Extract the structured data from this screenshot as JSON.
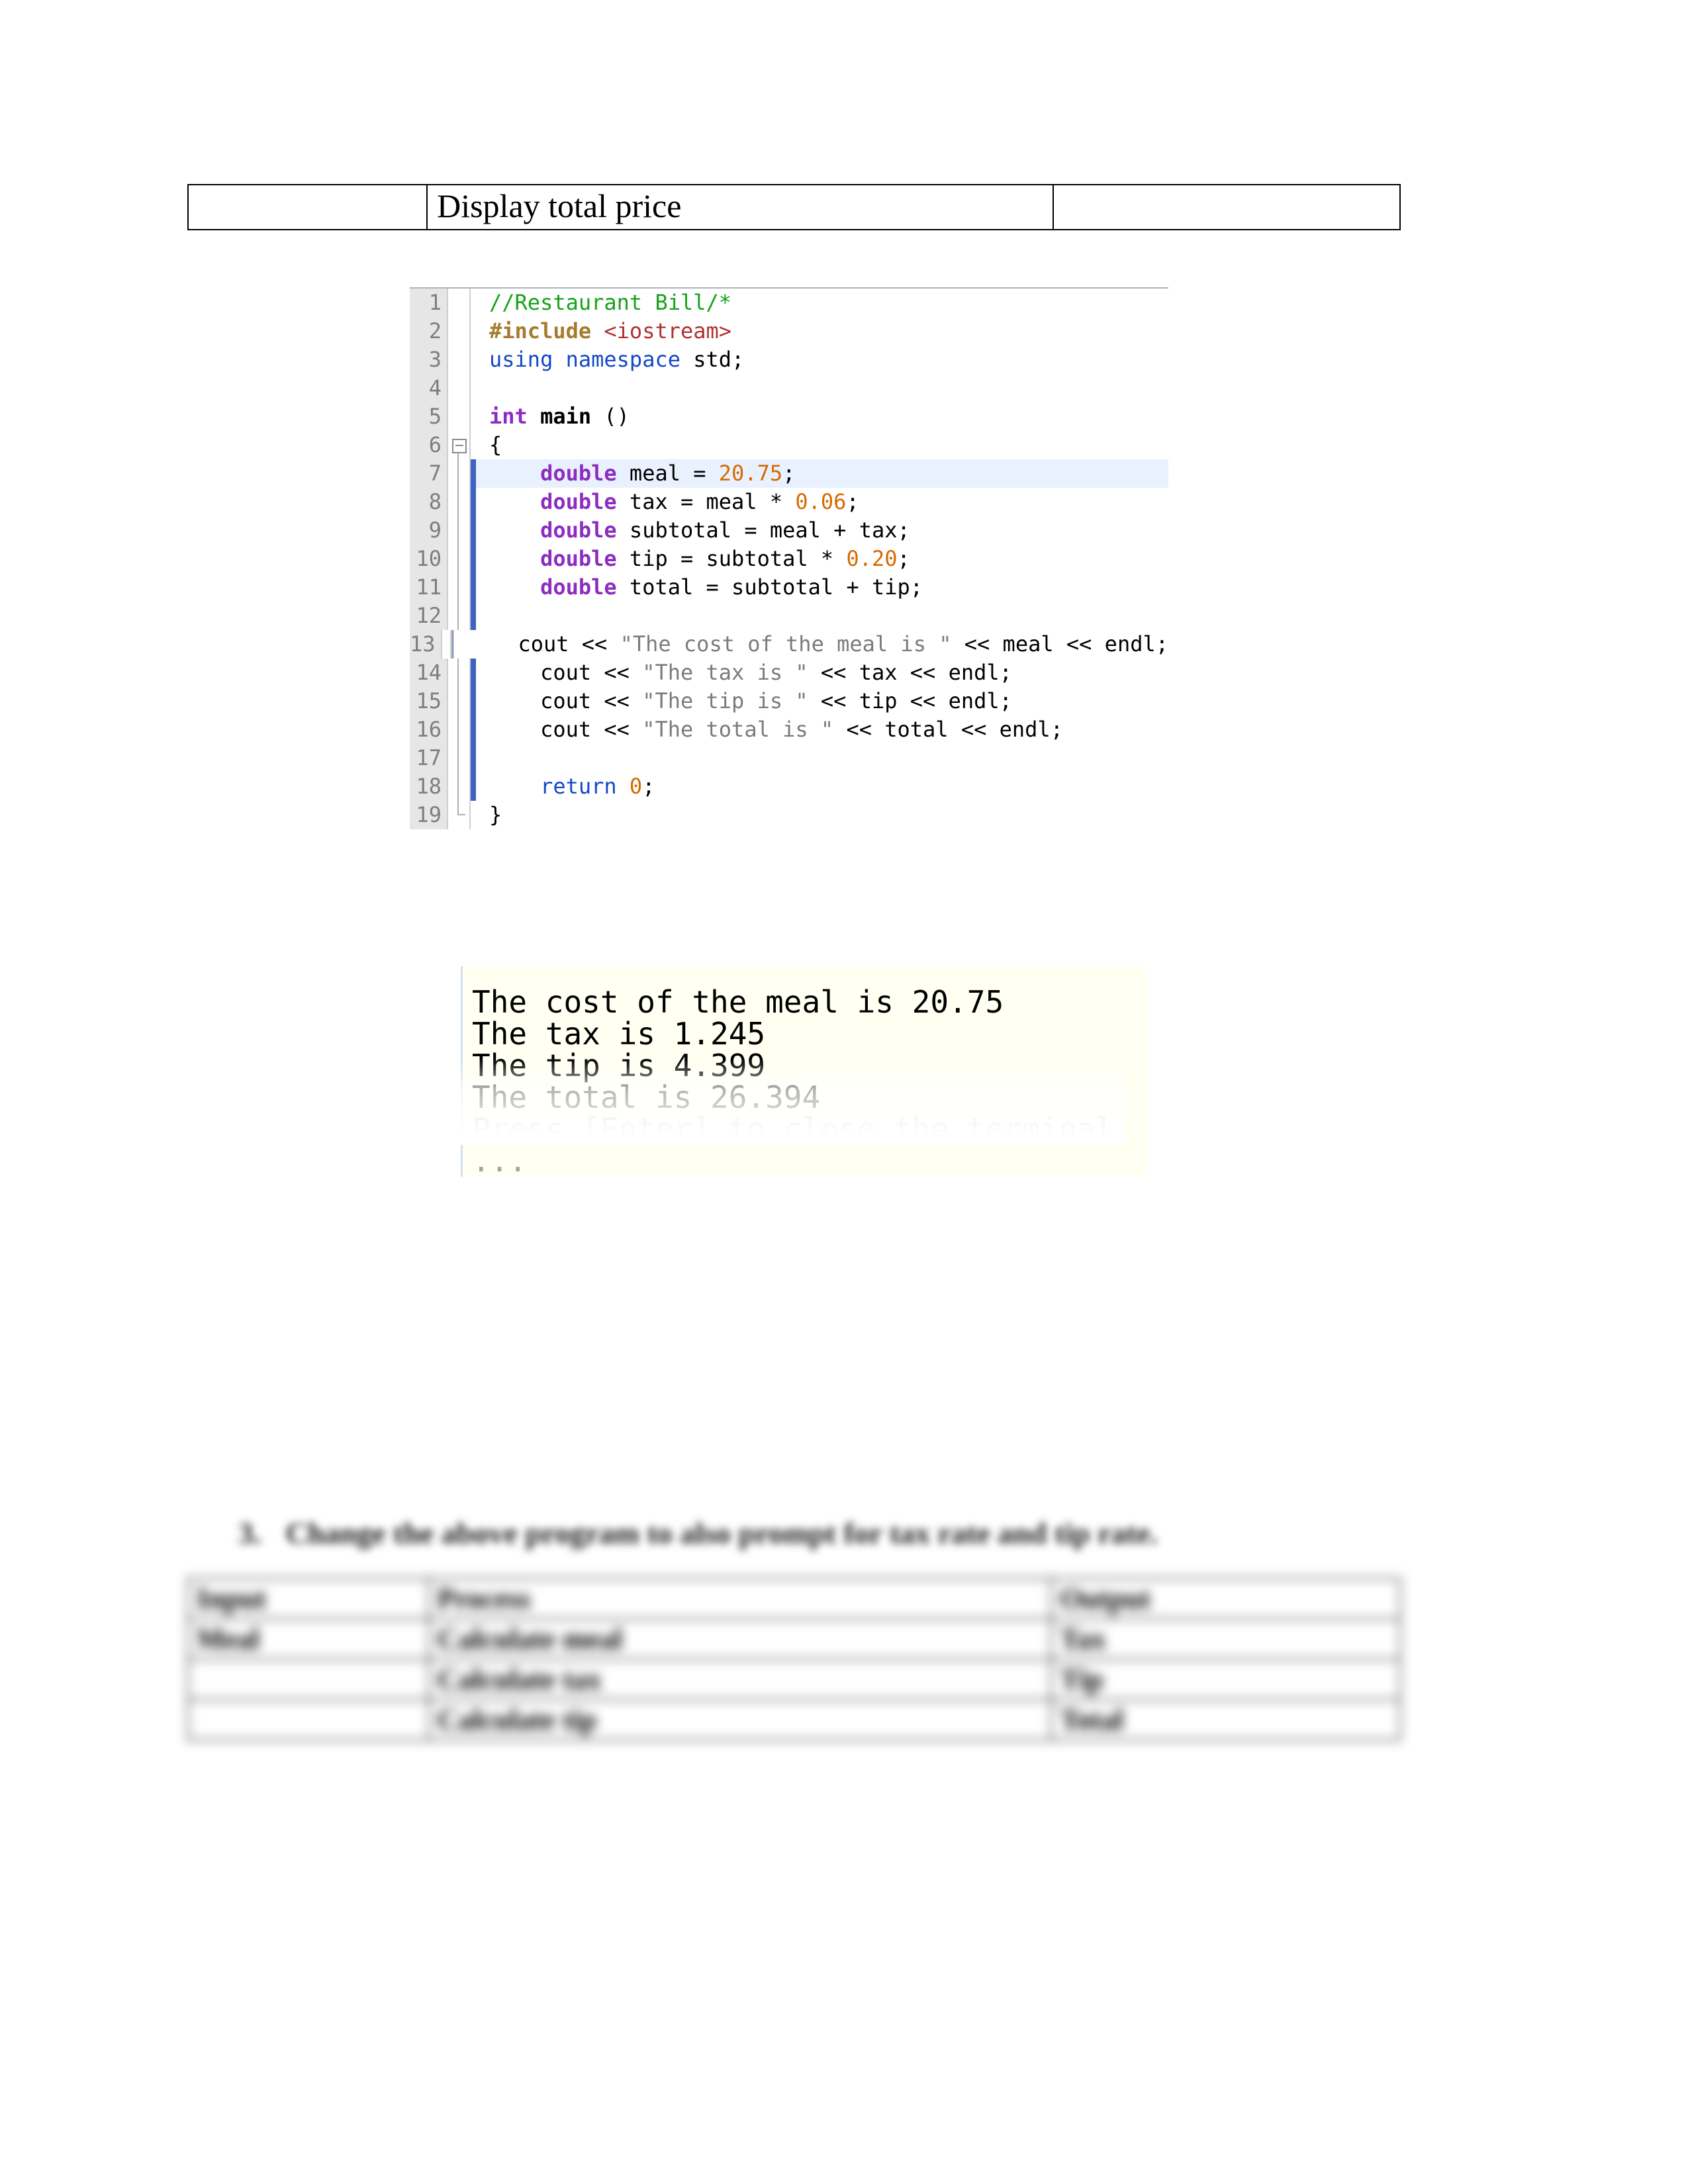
{
  "top_table": {
    "col1": "",
    "col2": "Display total price",
    "col3": ""
  },
  "code": {
    "lines": [
      {
        "n": 1,
        "hl": false,
        "sel": false,
        "fold": "",
        "frags": [
          {
            "t": "//Restaurant Bill/*",
            "c": "tok-comment"
          }
        ]
      },
      {
        "n": 2,
        "hl": false,
        "sel": false,
        "fold": "",
        "frags": [
          {
            "t": "#include ",
            "c": "tok-pre"
          },
          {
            "t": "<iostream>",
            "c": "tok-prearg"
          }
        ]
      },
      {
        "n": 3,
        "hl": false,
        "sel": false,
        "fold": "",
        "frags": [
          {
            "t": "using namespace ",
            "c": "tok-kw"
          },
          {
            "t": "std",
            "c": "tok-op"
          },
          {
            "t": ";",
            "c": "tok-op"
          }
        ]
      },
      {
        "n": 4,
        "hl": false,
        "sel": false,
        "fold": "",
        "frags": [
          {
            "t": "",
            "c": ""
          }
        ]
      },
      {
        "n": 5,
        "hl": false,
        "sel": false,
        "fold": "",
        "frags": [
          {
            "t": "int ",
            "c": "tok-type"
          },
          {
            "t": "main",
            "c": "tok-fn"
          },
          {
            "t": " ()",
            "c": "tok-op"
          }
        ]
      },
      {
        "n": 6,
        "hl": false,
        "sel": false,
        "fold": "start",
        "frags": [
          {
            "t": "{",
            "c": "tok-op"
          }
        ]
      },
      {
        "n": 7,
        "hl": true,
        "sel": true,
        "fold": "rail",
        "frags": [
          {
            "t": "    ",
            "c": ""
          },
          {
            "t": "double",
            "c": "tok-type"
          },
          {
            "t": " meal ",
            "c": "tok-op"
          },
          {
            "t": "=",
            "c": "tok-op"
          },
          {
            "t": " ",
            "c": ""
          },
          {
            "t": "20.75",
            "c": "tok-num"
          },
          {
            "t": ";",
            "c": "tok-op"
          }
        ]
      },
      {
        "n": 8,
        "hl": false,
        "sel": true,
        "fold": "rail",
        "frags": [
          {
            "t": "    ",
            "c": ""
          },
          {
            "t": "double",
            "c": "tok-type"
          },
          {
            "t": " tax ",
            "c": "tok-op"
          },
          {
            "t": "=",
            "c": "tok-op"
          },
          {
            "t": " meal ",
            "c": "tok-op"
          },
          {
            "t": "*",
            "c": "tok-op"
          },
          {
            "t": " ",
            "c": ""
          },
          {
            "t": "0.06",
            "c": "tok-num"
          },
          {
            "t": ";",
            "c": "tok-op"
          }
        ]
      },
      {
        "n": 9,
        "hl": false,
        "sel": true,
        "fold": "rail",
        "frags": [
          {
            "t": "    ",
            "c": ""
          },
          {
            "t": "double",
            "c": "tok-type"
          },
          {
            "t": " subtotal ",
            "c": "tok-op"
          },
          {
            "t": "=",
            "c": "tok-op"
          },
          {
            "t": " meal ",
            "c": "tok-op"
          },
          {
            "t": "+",
            "c": "tok-op"
          },
          {
            "t": " tax;",
            "c": "tok-op"
          }
        ]
      },
      {
        "n": 10,
        "hl": false,
        "sel": true,
        "fold": "rail",
        "frags": [
          {
            "t": "    ",
            "c": ""
          },
          {
            "t": "double",
            "c": "tok-type"
          },
          {
            "t": " tip ",
            "c": "tok-op"
          },
          {
            "t": "=",
            "c": "tok-op"
          },
          {
            "t": " subtotal ",
            "c": "tok-op"
          },
          {
            "t": "*",
            "c": "tok-op"
          },
          {
            "t": " ",
            "c": ""
          },
          {
            "t": "0.20",
            "c": "tok-num"
          },
          {
            "t": ";",
            "c": "tok-op"
          }
        ]
      },
      {
        "n": 11,
        "hl": false,
        "sel": true,
        "fold": "rail",
        "frags": [
          {
            "t": "    ",
            "c": ""
          },
          {
            "t": "double",
            "c": "tok-type"
          },
          {
            "t": " total ",
            "c": "tok-op"
          },
          {
            "t": "=",
            "c": "tok-op"
          },
          {
            "t": " subtotal ",
            "c": "tok-op"
          },
          {
            "t": "+",
            "c": "tok-op"
          },
          {
            "t": " tip;",
            "c": "tok-op"
          }
        ]
      },
      {
        "n": 12,
        "hl": false,
        "sel": true,
        "fold": "rail",
        "frags": [
          {
            "t": "",
            "c": ""
          }
        ]
      },
      {
        "n": 13,
        "hl": false,
        "sel": true,
        "fold": "rail",
        "frags": [
          {
            "t": "    cout ",
            "c": "tok-op"
          },
          {
            "t": "<<",
            "c": "tok-op"
          },
          {
            "t": " ",
            "c": ""
          },
          {
            "t": "\"The cost of the meal is \"",
            "c": "tok-str"
          },
          {
            "t": " ",
            "c": ""
          },
          {
            "t": "<<",
            "c": "tok-op"
          },
          {
            "t": " meal ",
            "c": "tok-op"
          },
          {
            "t": "<<",
            "c": "tok-op"
          },
          {
            "t": " endl;",
            "c": "tok-op"
          }
        ]
      },
      {
        "n": 14,
        "hl": false,
        "sel": true,
        "fold": "rail",
        "frags": [
          {
            "t": "    cout ",
            "c": "tok-op"
          },
          {
            "t": "<<",
            "c": "tok-op"
          },
          {
            "t": " ",
            "c": ""
          },
          {
            "t": "\"The tax is \"",
            "c": "tok-str"
          },
          {
            "t": " ",
            "c": ""
          },
          {
            "t": "<<",
            "c": "tok-op"
          },
          {
            "t": " tax ",
            "c": "tok-op"
          },
          {
            "t": "<<",
            "c": "tok-op"
          },
          {
            "t": " endl;",
            "c": "tok-op"
          }
        ]
      },
      {
        "n": 15,
        "hl": false,
        "sel": true,
        "fold": "rail",
        "frags": [
          {
            "t": "    cout ",
            "c": "tok-op"
          },
          {
            "t": "<<",
            "c": "tok-op"
          },
          {
            "t": " ",
            "c": ""
          },
          {
            "t": "\"The tip is \"",
            "c": "tok-str"
          },
          {
            "t": " ",
            "c": ""
          },
          {
            "t": "<<",
            "c": "tok-op"
          },
          {
            "t": " tip ",
            "c": "tok-op"
          },
          {
            "t": "<<",
            "c": "tok-op"
          },
          {
            "t": " endl;",
            "c": "tok-op"
          }
        ]
      },
      {
        "n": 16,
        "hl": false,
        "sel": true,
        "fold": "rail",
        "frags": [
          {
            "t": "    cout ",
            "c": "tok-op"
          },
          {
            "t": "<<",
            "c": "tok-op"
          },
          {
            "t": " ",
            "c": ""
          },
          {
            "t": "\"The total is \"",
            "c": "tok-str"
          },
          {
            "t": " ",
            "c": ""
          },
          {
            "t": "<<",
            "c": "tok-op"
          },
          {
            "t": " total ",
            "c": "tok-op"
          },
          {
            "t": "<<",
            "c": "tok-op"
          },
          {
            "t": " endl;",
            "c": "tok-op"
          }
        ]
      },
      {
        "n": 17,
        "hl": false,
        "sel": true,
        "fold": "rail",
        "frags": [
          {
            "t": "",
            "c": ""
          }
        ]
      },
      {
        "n": 18,
        "hl": false,
        "sel": true,
        "fold": "rail",
        "frags": [
          {
            "t": "    ",
            "c": ""
          },
          {
            "t": "return ",
            "c": "tok-kw"
          },
          {
            "t": "0",
            "c": "tok-num"
          },
          {
            "t": ";",
            "c": "tok-op"
          }
        ]
      },
      {
        "n": 19,
        "hl": false,
        "sel": false,
        "fold": "end",
        "frags": [
          {
            "t": "}",
            "c": "tok-op"
          }
        ]
      }
    ]
  },
  "console": {
    "lines": [
      "The cost of the meal is 20.75",
      "The tax is 1.245",
      "The tip is 4.399",
      "The total is 26.394"
    ],
    "dim_line": "Press [Enter] to close the terminal ..."
  },
  "question": {
    "num": "3.",
    "text": "Change the above program to also prompt for tax rate and tip rate."
  },
  "bottom_table": {
    "rows": [
      {
        "c1": "Input",
        "c2": "Process",
        "c3": "Output"
      },
      {
        "c1": "Meal",
        "c2": "Calculate meal",
        "c3": "Tax"
      },
      {
        "c1": "",
        "c2": "Calculate tax",
        "c3": "Tip"
      },
      {
        "c1": "",
        "c2": "Calculate tip",
        "c3": "Total"
      }
    ]
  }
}
